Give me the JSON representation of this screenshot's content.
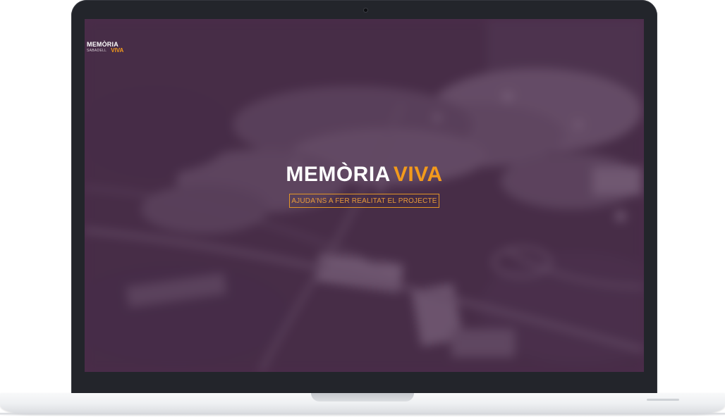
{
  "site_logo": {
    "line1": "MEMÒRIA",
    "line2_sub": "SABADELL",
    "line2_accent": "VIVA"
  },
  "hero": {
    "title_white": "MEMÒRIA",
    "title_accent": "VIVA",
    "cta_label": "AJUDA'NS A FER REALITAT EL PROJECTE"
  },
  "colors": {
    "accent": "#f39a1c",
    "overlay": "#4e2a4c",
    "bezel": "#23252b"
  },
  "icons": {
    "camera": "webcam-dot-icon"
  }
}
